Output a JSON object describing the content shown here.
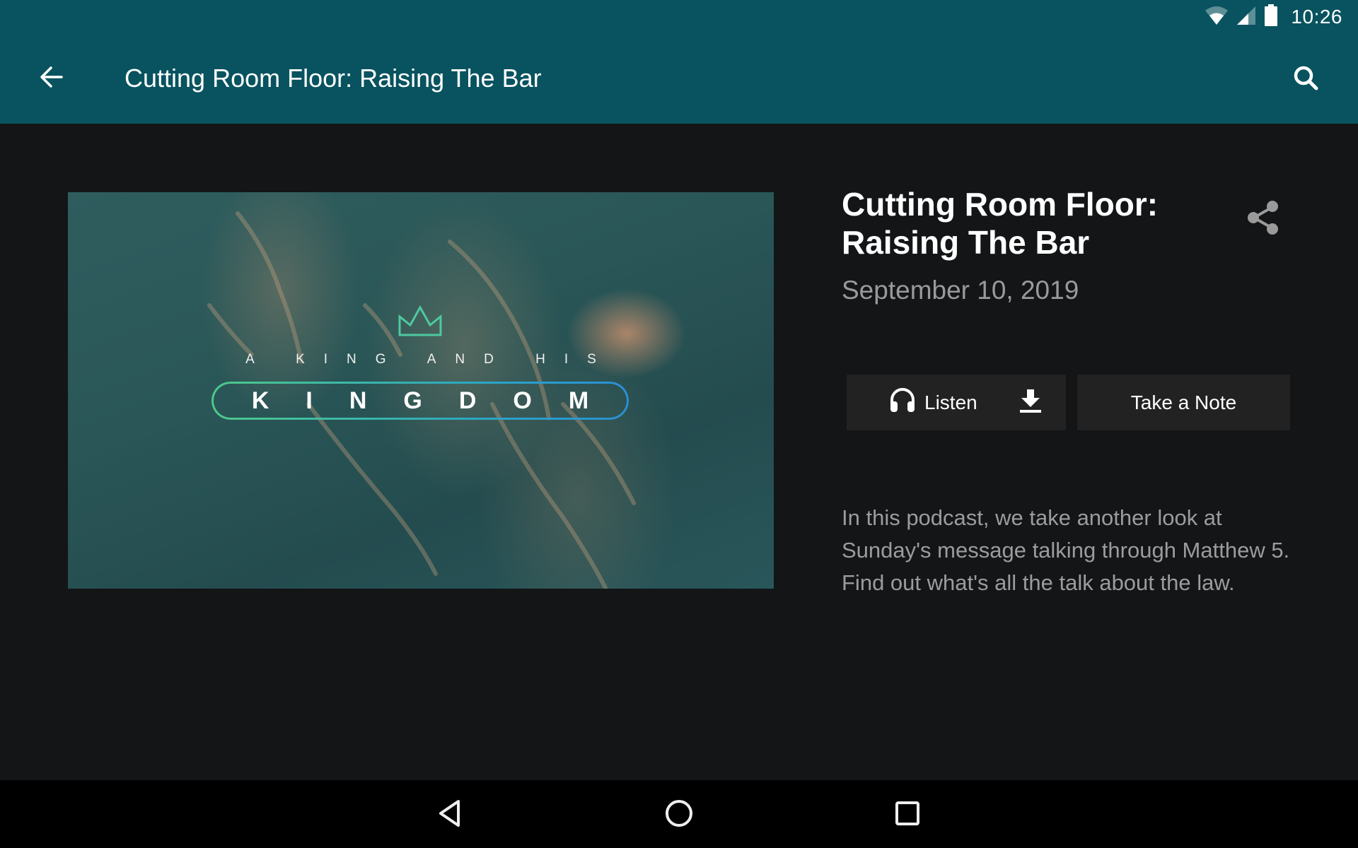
{
  "status_bar": {
    "time": "10:26",
    "icons": [
      "wifi-icon",
      "cell-signal-icon",
      "battery-icon"
    ]
  },
  "app_bar": {
    "title": "Cutting Room Floor: Raising The Bar",
    "back_icon": "arrow-back-icon",
    "search_icon": "search-icon",
    "color": "#08535f"
  },
  "artwork": {
    "subtitle": "A KING AND HIS",
    "title": "KINGDOM",
    "crown_icon": "crown-icon",
    "accent_colors": [
      "#4ec98a",
      "#2a8fd4"
    ]
  },
  "detail": {
    "title": "Cutting Room Floor: Raising The Bar",
    "date": "September 10, 2019",
    "share_icon": "share-icon",
    "description": "In this podcast, we take another look at Sunday's message talking through Matthew 5. Find out what's all the talk about the law."
  },
  "actions": {
    "listen_label": "Listen",
    "listen_icon": "headphones-icon",
    "download_icon": "download-icon",
    "note_label": "Take a Note"
  },
  "nav_bar": {
    "buttons": [
      "back",
      "home",
      "recents"
    ]
  }
}
